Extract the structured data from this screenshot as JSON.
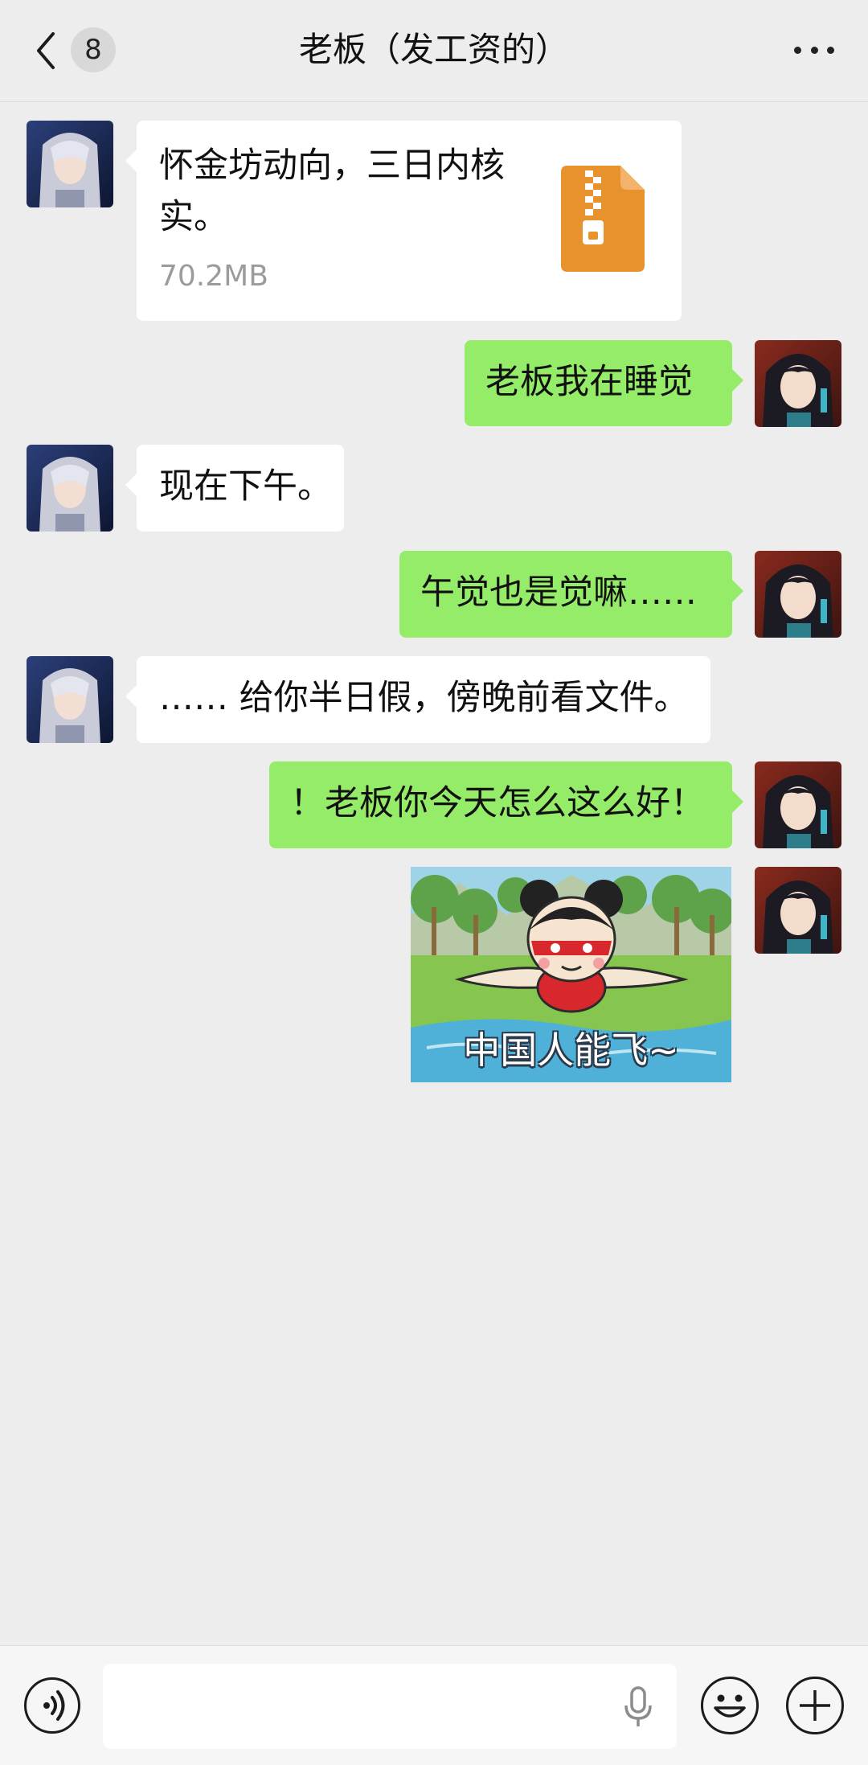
{
  "header": {
    "back_icon": "chevron-left-icon",
    "unread_count": "8",
    "title": "老板（发工资的）",
    "more_icon": "more-dots-icon"
  },
  "messages": [
    {
      "side": "left",
      "type": "file",
      "text": "怀金坊动向，三日内核实。",
      "file_size": "70.2MB",
      "icon": "zip-file-icon"
    },
    {
      "side": "right",
      "type": "text",
      "text": "老板我在睡觉"
    },
    {
      "side": "left",
      "type": "text",
      "text": "现在下午。"
    },
    {
      "side": "right",
      "type": "text",
      "text": "午觉也是觉嘛……"
    },
    {
      "side": "left",
      "type": "text",
      "text": "…… 给你半日假，傍晚前看文件。"
    },
    {
      "side": "right",
      "type": "text",
      "text": "！老板你今天怎么这么好！"
    },
    {
      "side": "right",
      "type": "sticker",
      "caption": "中国人能飞~"
    }
  ],
  "input_bar": {
    "voice_icon": "voice-toggle-icon",
    "mic_icon": "microphone-icon",
    "emoji_icon": "emoji-icon",
    "plus_icon": "plus-icon",
    "input_value": ""
  },
  "colors": {
    "background": "#ededed",
    "bubble_self": "#95ec69",
    "bubble_other": "#ffffff",
    "file_icon": "#e8922e"
  }
}
